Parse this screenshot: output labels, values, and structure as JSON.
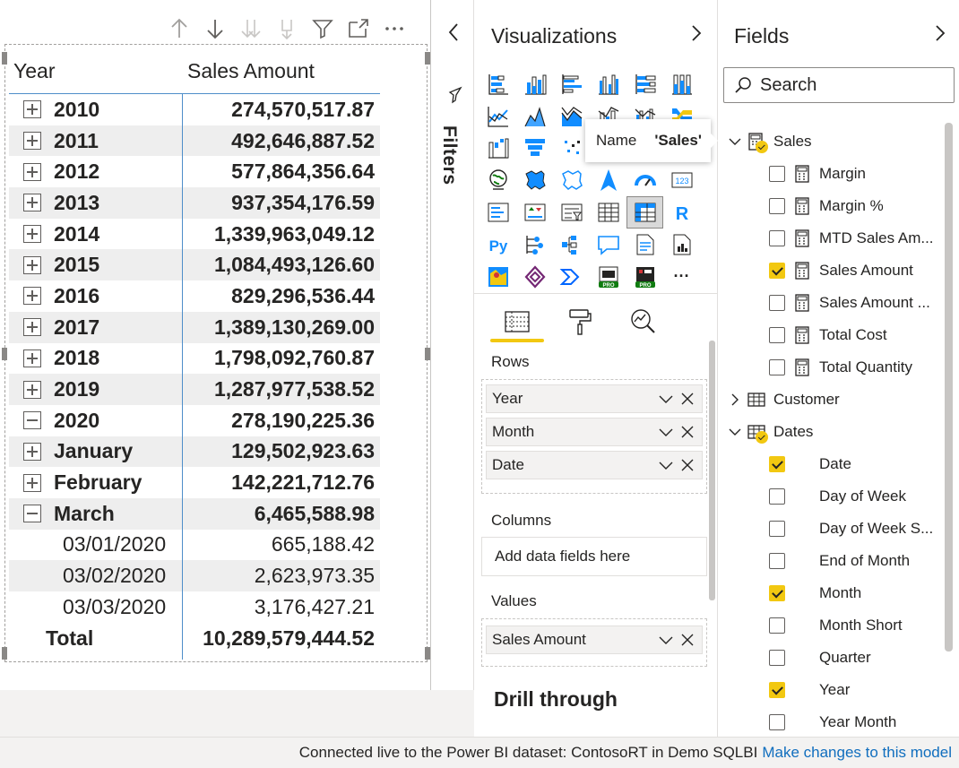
{
  "matrix": {
    "headers": {
      "year": "Year",
      "sales": "Sales Amount"
    },
    "rows": [
      {
        "label": "2010",
        "value": "274,570,517.87"
      },
      {
        "label": "2011",
        "value": "492,646,887.52"
      },
      {
        "label": "2012",
        "value": "577,864,356.64"
      },
      {
        "label": "2013",
        "value": "937,354,176.59"
      },
      {
        "label": "2014",
        "value": "1,339,963,049.12"
      },
      {
        "label": "2015",
        "value": "1,084,493,126.60"
      },
      {
        "label": "2016",
        "value": "829,296,536.44"
      },
      {
        "label": "2017",
        "value": "1,389,130,269.00"
      },
      {
        "label": "2018",
        "value": "1,798,092,760.87"
      },
      {
        "label": "2019",
        "value": "1,287,977,538.52"
      },
      {
        "label": "2020",
        "value": "278,190,225.36"
      },
      {
        "label": "January",
        "value": "129,502,923.63"
      },
      {
        "label": "February",
        "value": "142,221,712.76"
      },
      {
        "label": "March",
        "value": "6,465,588.98"
      },
      {
        "label": "03/01/2020",
        "value": "665,188.42"
      },
      {
        "label": "03/02/2020",
        "value": "2,623,973.35"
      },
      {
        "label": "03/03/2020",
        "value": "3,176,427.21"
      },
      {
        "label": "Total",
        "value": "10,289,579,444.52"
      }
    ]
  },
  "filters": {
    "label": "Filters"
  },
  "visualizations": {
    "title": "Visualizations",
    "tooltip": {
      "name_label": "Name",
      "name_value": "'Sales'"
    },
    "rows_label": "Rows",
    "rows_fields": [
      "Year",
      "Month",
      "Date"
    ],
    "columns_label": "Columns",
    "columns_placeholder": "Add data fields here",
    "values_label": "Values",
    "values_fields": [
      "Sales Amount"
    ],
    "drill_through": "Drill through",
    "more": "···"
  },
  "fields": {
    "title": "Fields",
    "search_placeholder": "Search",
    "tables": [
      {
        "name": "Sales"
      },
      {
        "name": "Customer"
      },
      {
        "name": "Dates"
      }
    ],
    "sales_fields": [
      {
        "name": "Margin",
        "checked": false
      },
      {
        "name": "Margin %",
        "checked": false
      },
      {
        "name": "MTD Sales Am...",
        "checked": false
      },
      {
        "name": "Sales Amount",
        "checked": true
      },
      {
        "name": "Sales Amount ...",
        "checked": false
      },
      {
        "name": "Total Cost",
        "checked": false
      },
      {
        "name": "Total Quantity",
        "checked": false
      }
    ],
    "dates_fields": [
      {
        "name": "Date",
        "checked": true
      },
      {
        "name": "Day of Week",
        "checked": false
      },
      {
        "name": "Day of Week S...",
        "checked": false
      },
      {
        "name": "End of Month",
        "checked": false
      },
      {
        "name": "Month",
        "checked": true
      },
      {
        "name": "Month Short",
        "checked": false
      },
      {
        "name": "Quarter",
        "checked": false
      },
      {
        "name": "Year",
        "checked": true
      },
      {
        "name": "Year Month",
        "checked": false
      }
    ]
  },
  "status": {
    "text": "Connected live to the Power BI dataset: ContosoRT in Demo SQLBI",
    "link": "Make changes to this model"
  },
  "colors": {
    "accent": "#f2c811",
    "link": "#106ebe",
    "divider": "#4f8ec9"
  }
}
